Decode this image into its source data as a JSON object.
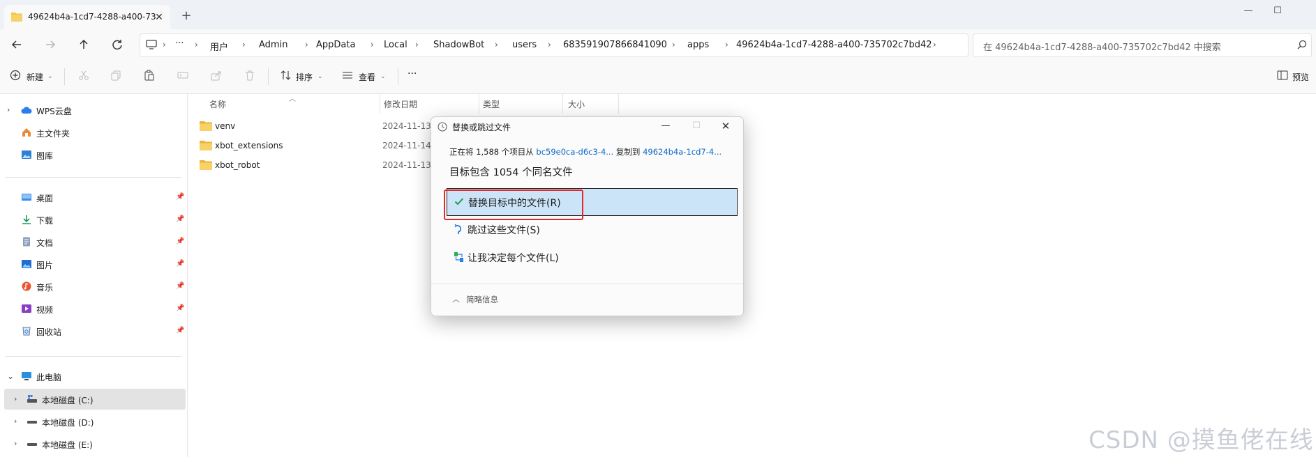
{
  "tab": {
    "title": "49624b4a-1cd7-4288-a400-73",
    "close": "✕",
    "new": "+"
  },
  "window": {
    "minimize": "—",
    "maximize": "☐"
  },
  "breadcrumb": [
    "用户",
    "Admin",
    "AppData",
    "Local",
    "ShadowBot",
    "users",
    "683591907866841090",
    "apps",
    "49624b4a-1cd7-4288-a400-735702c7bd42"
  ],
  "search": {
    "placeholder": "在 49624b4a-1cd7-4288-a400-735702c7bd42 中搜索"
  },
  "toolbar": {
    "new": "新建",
    "sort": "排序",
    "view": "查看",
    "more": "···",
    "preview": "预览"
  },
  "columns": {
    "name": "名称",
    "modified": "修改日期",
    "type": "类型",
    "size": "大小"
  },
  "files": [
    {
      "name": "venv",
      "date": "2024-11-13"
    },
    {
      "name": "xbot_extensions",
      "date": "2024-11-14"
    },
    {
      "name": "xbot_robot",
      "date": "2024-11-13"
    }
  ],
  "sidebar": {
    "top": [
      {
        "label": "WPS云盘",
        "icon": "cloud-icon"
      },
      {
        "label": "主文件夹",
        "icon": "home-icon"
      },
      {
        "label": "图库",
        "icon": "gallery-icon"
      }
    ],
    "pinned": [
      {
        "label": "桌面",
        "icon": "desktop-icon"
      },
      {
        "label": "下载",
        "icon": "download-icon"
      },
      {
        "label": "文档",
        "icon": "document-icon"
      },
      {
        "label": "图片",
        "icon": "pictures-icon"
      },
      {
        "label": "音乐",
        "icon": "music-icon"
      },
      {
        "label": "视频",
        "icon": "video-icon"
      },
      {
        "label": "回收站",
        "icon": "recycle-bin-icon"
      }
    ],
    "this_pc": "此电脑",
    "drives": [
      {
        "label": "本地磁盘 (C:)",
        "selected": true
      },
      {
        "label": "本地磁盘 (D:)",
        "selected": false
      },
      {
        "label": "本地磁盘 (E:)",
        "selected": false
      }
    ]
  },
  "dialog": {
    "title": "替换或跳过文件",
    "line1_prefix": "正在将 1,588 个项目从",
    "source": "bc59e0ca-d6c3-4...",
    "line1_mid": "复制到",
    "dest": "49624b4a-1cd7-4...",
    "line2": "目标包含 1054 个同名文件",
    "options": [
      "替换目标中的文件(R)",
      "跳过这些文件(S)",
      "让我决定每个文件(L)"
    ],
    "footer": "简略信息"
  },
  "watermark": "CSDN @摸鱼佬在线",
  "colors": {
    "accent": "#0a67c8",
    "selected_option": "#cce4f7",
    "highlight_box": "#e5262a",
    "folder": "#f5c445"
  }
}
